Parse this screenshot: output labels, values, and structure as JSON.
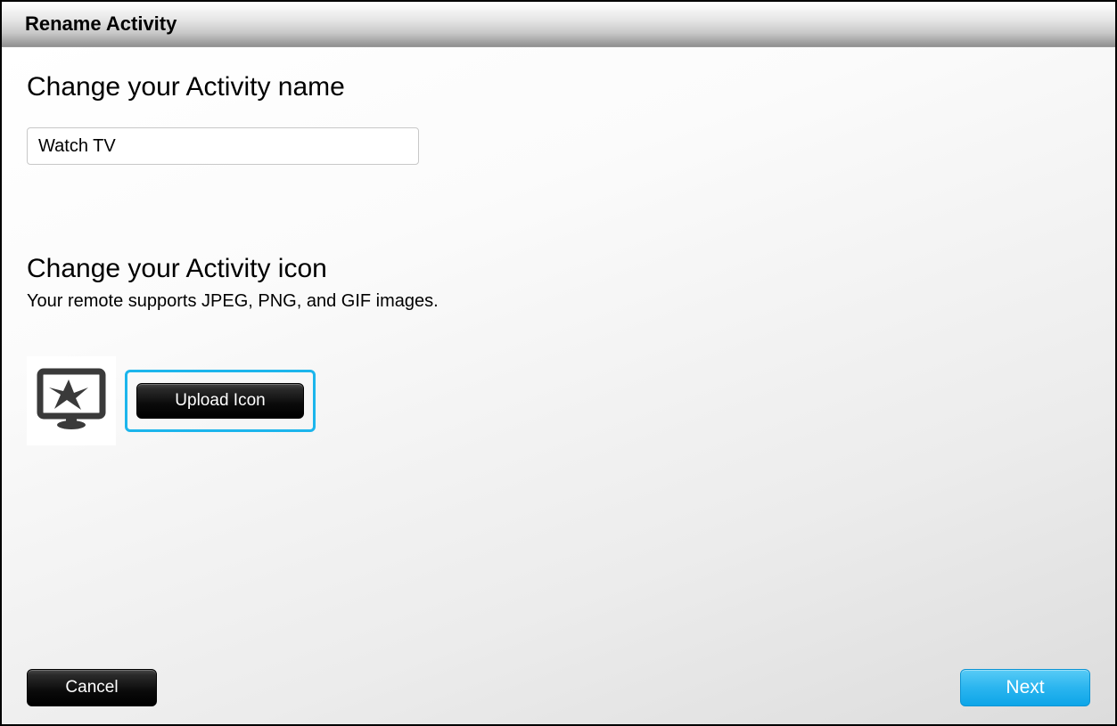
{
  "dialog": {
    "title": "Rename Activity"
  },
  "name_section": {
    "heading": "Change your Activity name",
    "input_value": "Watch TV"
  },
  "icon_section": {
    "heading": "Change your Activity icon",
    "subtext": "Your remote supports JPEG, PNG, and GIF images.",
    "upload_label": "Upload Icon"
  },
  "footer": {
    "cancel_label": "Cancel",
    "next_label": "Next"
  }
}
